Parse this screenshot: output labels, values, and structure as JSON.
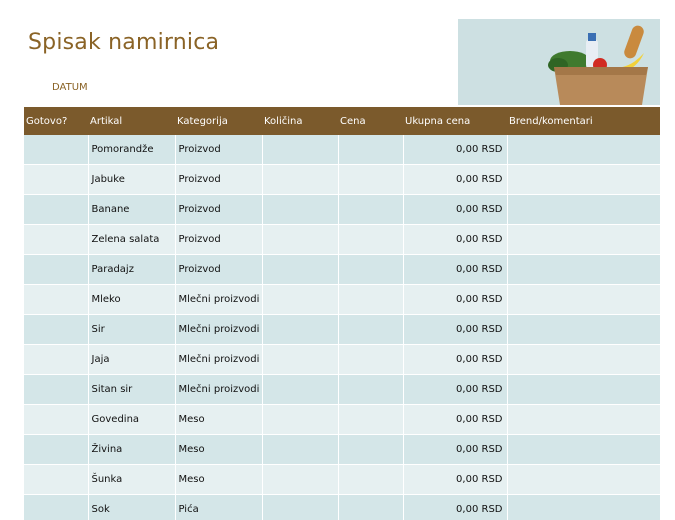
{
  "header": {
    "title": "Spisak namirnica",
    "date_label": "DATUM"
  },
  "image": {
    "icon": "grocery-bag-photo"
  },
  "table": {
    "columns": [
      "Gotovo?",
      "Artikal",
      "Kategorija",
      "Količina",
      "Cena",
      "Ukupna cena",
      "Brend/komentari"
    ],
    "rows": [
      {
        "item": "Pomorandže",
        "category": "Proizvod",
        "total": "0,00 RSD"
      },
      {
        "item": "Jabuke",
        "category": "Proizvod",
        "total": "0,00 RSD"
      },
      {
        "item": "Banane",
        "category": "Proizvod",
        "total": "0,00 RSD"
      },
      {
        "item": "Zelena salata",
        "category": "Proizvod",
        "total": "0,00 RSD"
      },
      {
        "item": "Paradajz",
        "category": "Proizvod",
        "total": "0,00 RSD"
      },
      {
        "item": "Mleko",
        "category": "Mlečni proizvodi",
        "total": "0,00 RSD"
      },
      {
        "item": "Sir",
        "category": "Mlečni proizvodi",
        "total": "0,00 RSD"
      },
      {
        "item": "Jaja",
        "category": "Mlečni proizvodi",
        "total": "0,00 RSD"
      },
      {
        "item": "Sitan sir",
        "category": "Mlečni proizvodi",
        "total": "0,00 RSD"
      },
      {
        "item": "Govedina",
        "category": "Meso",
        "total": "0,00 RSD"
      },
      {
        "item": "Živina",
        "category": "Meso",
        "total": "0,00 RSD"
      },
      {
        "item": "Šunka",
        "category": "Meso",
        "total": "0,00 RSD"
      },
      {
        "item": "Sok",
        "category": "Pića",
        "total": "0,00 RSD"
      }
    ]
  },
  "colors": {
    "title": "#8a6326",
    "header_bg": "#7b5a2c",
    "row_odd": "#d4e6e8",
    "row_even": "#e6f0f1"
  }
}
